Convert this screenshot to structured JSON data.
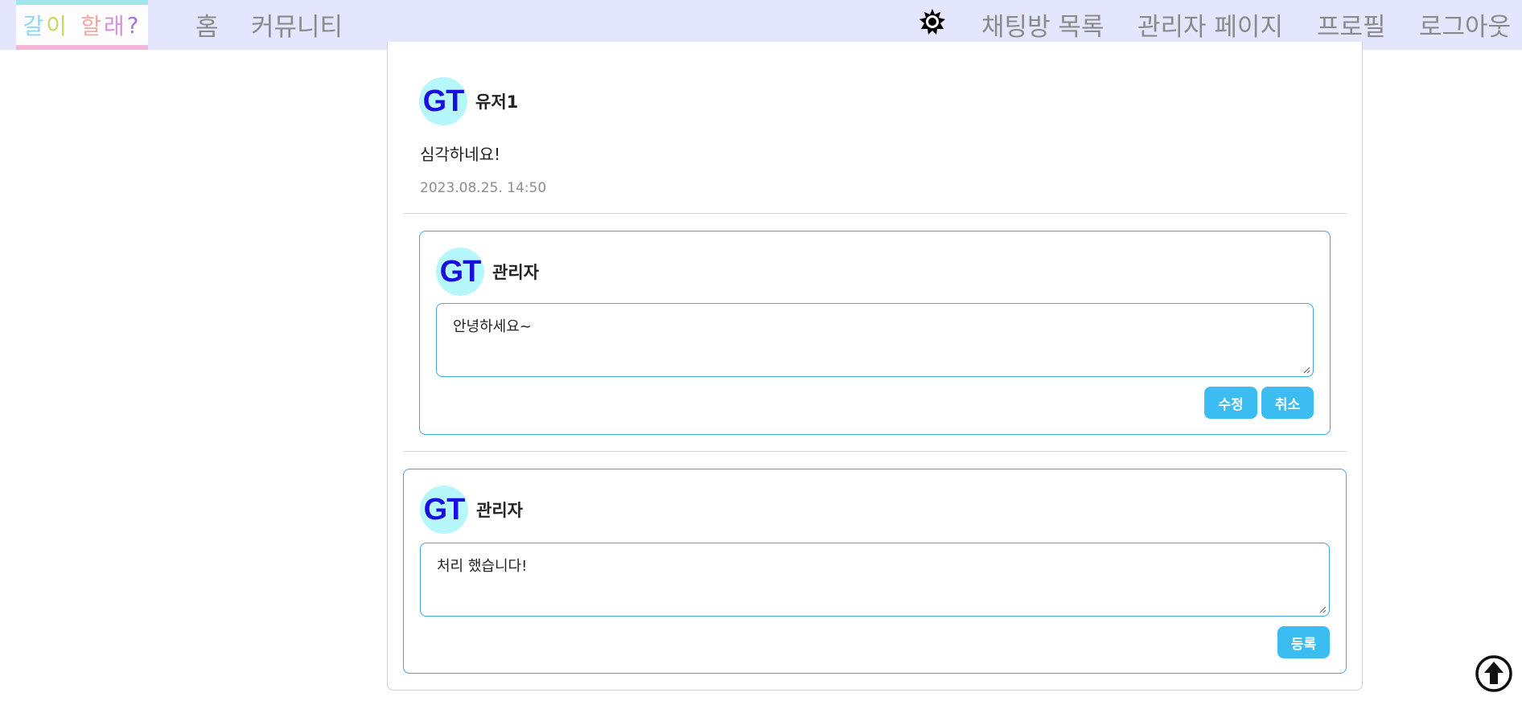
{
  "nav": {
    "logo_chars": [
      "갈",
      "이",
      "할",
      "래",
      "?"
    ],
    "home": "홈",
    "community": "커뮤니티",
    "theme_icon": "sun-icon",
    "chat_list": "채팅방 목록",
    "admin_page": "관리자 페이지",
    "profile": "프로필",
    "logout": "로그아웃"
  },
  "comment": {
    "avatar": "GT",
    "author": "유저1",
    "text": "심각하네요!",
    "timestamp": "2023.08.25. 14:50"
  },
  "edit_reply": {
    "avatar": "GT",
    "author": "관리자",
    "value": "안녕하세요~",
    "edit_button": "수정",
    "cancel_button": "취소"
  },
  "new_reply": {
    "avatar": "GT",
    "author": "관리자",
    "value": "처리 했습니다!",
    "submit_button": "등록"
  },
  "scroll_top_icon": "arrow-up-circle-icon",
  "colors": {
    "navbar_bg": "#e3e6fc",
    "accent": "#3bbdf2",
    "border_accent": "#3ea6e6",
    "avatar_bg": "#b6f7fb",
    "avatar_text": "#1b0fe0"
  }
}
